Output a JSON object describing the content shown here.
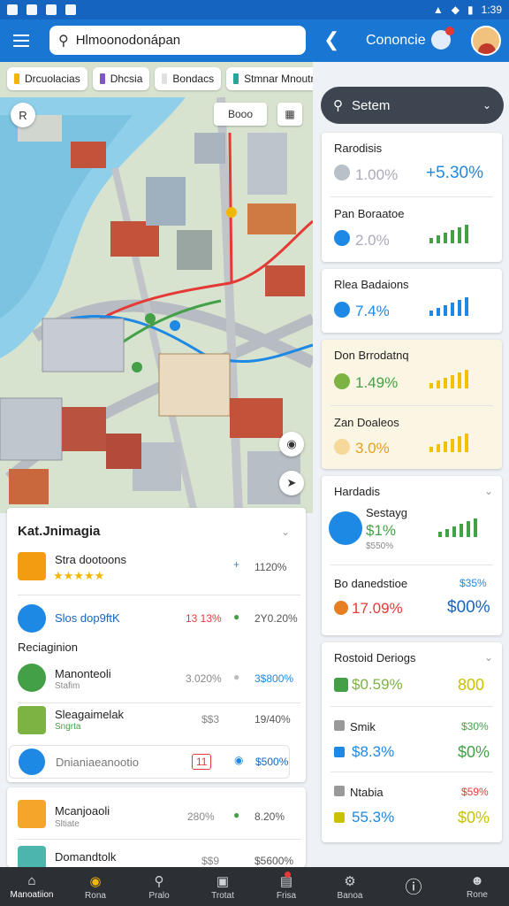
{
  "status": {
    "time": "1:39",
    "icons": [
      "wifi",
      "signal",
      "battery"
    ]
  },
  "appbar": {
    "search_value": "Hlmoonodonápan",
    "title": "Cononcie",
    "menu_icon": "menu-icon",
    "back_icon": "back-arrow-icon"
  },
  "map": {
    "chips": [
      {
        "label": "Drcuolacias",
        "color": "#f2b705"
      },
      {
        "label": "Dhcsia",
        "color": "#7e57c2"
      },
      {
        "label": "Bondacs",
        "color": "#e0e0e0"
      },
      {
        "label": "Stmnar Mnoutrate",
        "color": "#26a69a"
      }
    ],
    "compass_label": "R",
    "layer_label": "Booo"
  },
  "left_card": {
    "title": "Kat.Jnimagia",
    "rows": [
      {
        "name": "Stra dootoons",
        "stars": "★★★★★",
        "value2": "1120%",
        "icon_color": "#f39c12"
      },
      {
        "name": "Slos dop9ftK",
        "value1": "13 13%",
        "value2": "2Y0.20%",
        "icon_color": "#1e88e5"
      }
    ],
    "section": "Reciaginion",
    "rows2": [
      {
        "name": "Manonteoli",
        "sub": "Stafim",
        "value1": "3.020%",
        "value2": "3$800%",
        "icon_color": "#43a047"
      },
      {
        "name": "Sleagaimelak",
        "sub": "Sngrta",
        "value1": "$$3",
        "value2": "19/40%",
        "icon_color": "#7cb342"
      },
      {
        "name": "Dnianiaeanootio",
        "value1": "11",
        "value2": "$500%",
        "icon_color": "#1e88e5"
      }
    ]
  },
  "left_card2": {
    "rows": [
      {
        "name": "Mcanjoaoli",
        "sub": "Sltiate",
        "value1": "280%",
        "value2": "8.20%",
        "icon_color": "#f4a62a"
      },
      {
        "name": "Domandtolk",
        "value1": "$$9",
        "value2": "$5600%",
        "icon_color": "#4db6ac"
      }
    ]
  },
  "right_panel": {
    "dropdown": "Setem",
    "cards": [
      {
        "name": "Rarodisis",
        "value": "1.00%",
        "big": "+5.30%"
      },
      {
        "name": "Pan Boraatoe",
        "value": "2.0%"
      },
      {
        "name": "Rlea Badaions",
        "value": "7.4%"
      },
      {
        "name": "Don Brrodatnq",
        "value": "1.49%"
      },
      {
        "name": "Zan Doaleos",
        "value": "3.0%"
      }
    ],
    "card2": {
      "title": "Hardadis",
      "name": "Sestayg",
      "value": "$1%",
      "sub": "$550%",
      "row_name": "Bo danedstioe",
      "row_pct": "$35%",
      "row_value": "17.09%",
      "row_big": "$00%"
    },
    "card3": {
      "title": "Rostoid Deriogs",
      "v1": "$0.59%",
      "b1": "800",
      "name2": "Smik",
      "p2": "$30%",
      "v2": "$8.3%",
      "b2": "$0%",
      "name3": "Ntabia",
      "p3": "$59%",
      "v3": "55.3%",
      "b3": "$0%"
    }
  },
  "bottom_nav": [
    {
      "label": "Manoatiion",
      "icon": "home-icon",
      "active": true
    },
    {
      "label": "Rona",
      "icon": "circle-icon"
    },
    {
      "label": "Pralo",
      "icon": "search-icon"
    },
    {
      "label": "Trotat",
      "icon": "image-icon"
    },
    {
      "label": "Frisa",
      "icon": "bag-icon",
      "badge": true
    },
    {
      "label": "Banoa",
      "icon": "gear-icon"
    },
    {
      "label": "",
      "icon": "alert-icon"
    },
    {
      "label": "Rone",
      "icon": "person-icon"
    }
  ]
}
